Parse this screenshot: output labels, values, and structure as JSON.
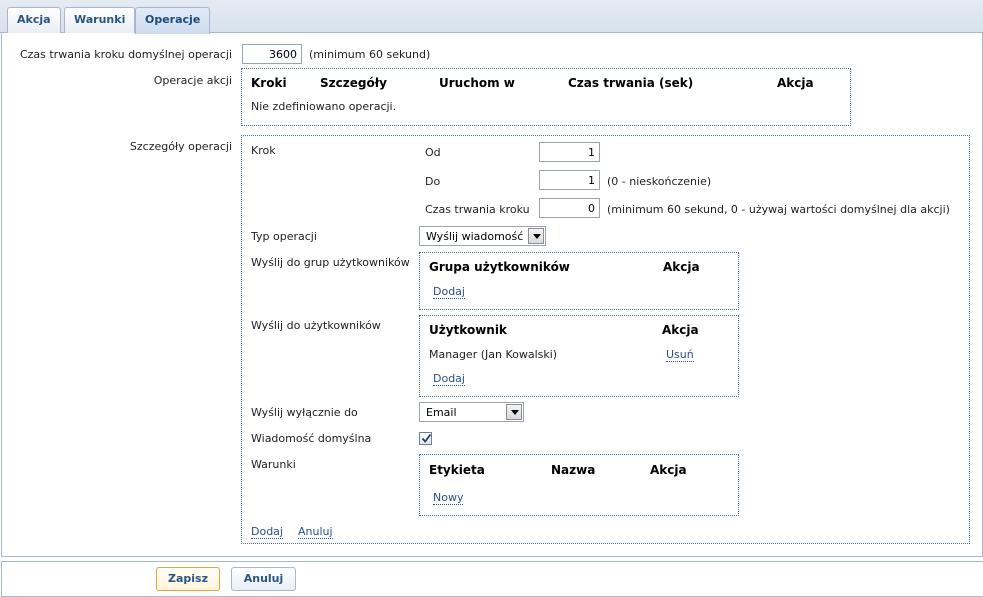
{
  "tabs": [
    {
      "label": "Akcja",
      "active": false
    },
    {
      "label": "Warunki",
      "active": false
    },
    {
      "label": "Operacje",
      "active": true
    }
  ],
  "default_step": {
    "label": "Czas trwania kroku domyślnej operacji",
    "value": "3600",
    "hint": "(minimum 60 sekund)"
  },
  "action_operations": {
    "label": "Operacje akcji",
    "columns": [
      "Kroki",
      "Szczegóły",
      "Uruchom w",
      "Czas trwania (sek)",
      "Akcja"
    ],
    "empty_text": "Nie zdefiniowano operacji."
  },
  "operation_details": {
    "label": "Szczegóły operacji",
    "step": {
      "label": "Krok",
      "from_label": "Od",
      "from_value": "1",
      "to_label": "Do",
      "to_value": "1",
      "to_hint": "(0 - nieskończenie)",
      "duration_label": "Czas trwania kroku",
      "duration_value": "0",
      "duration_hint": "(minimum 60 sekund, 0 - używaj wartości domyślnej dla akcji)"
    },
    "operation_type": {
      "label": "Typ operacji",
      "value": "Wyślij wiadomość"
    },
    "send_to_groups": {
      "label": "Wyślij do grup użytkowników",
      "columns": [
        "Grupa użytkowników",
        "Akcja"
      ],
      "add_label": "Dodaj"
    },
    "send_to_users": {
      "label": "Wyślij do użytkowników",
      "columns": [
        "Użytkownik",
        "Akcja"
      ],
      "rows": [
        {
          "user": "Manager (Jan Kowalski)",
          "action": "Usuń"
        }
      ],
      "add_label": "Dodaj"
    },
    "send_only_to": {
      "label": "Wyślij wyłącznie do",
      "value": "Email"
    },
    "default_message": {
      "label": "Wiadomość domyślna",
      "checked": true
    },
    "conditions": {
      "label": "Warunki",
      "columns": [
        "Etykieta",
        "Nazwa",
        "Akcja"
      ],
      "new_label": "Nowy"
    },
    "add_label": "Dodaj",
    "cancel_label": "Anuluj"
  },
  "footer": {
    "save_label": "Zapisz",
    "cancel_label": "Anuluj"
  },
  "colors": {
    "link": "#2b4f87",
    "tab_text": "#2b5681",
    "border": "#a7b8cc",
    "primary_border": "#e0a53c"
  }
}
